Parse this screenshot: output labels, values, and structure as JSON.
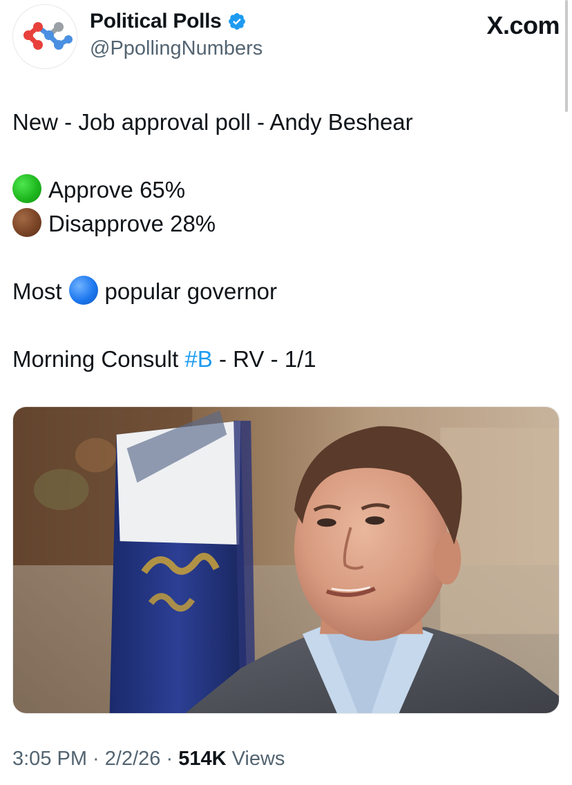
{
  "author": {
    "display_name": "Political Polls",
    "handle": "@PpollingNumbers",
    "avatar_icon": "network-molecule-logo",
    "verified_icon": "verified-badge-icon",
    "verified_color": "#1d9bf0"
  },
  "brand": {
    "label": "X.com"
  },
  "tweet": {
    "headline": "New - Job approval poll - Andy Beshear",
    "approve": {
      "icon": "green-circle",
      "color": "#1fb81f",
      "label": "Approve 65%"
    },
    "disapprove": {
      "icon": "brown-circle",
      "color": "#7a4426",
      "label": "Disapprove 28%"
    },
    "ranking": {
      "prefix": "Most",
      "icon": "blue-circle",
      "color": "#1e78ef",
      "suffix": "popular governor"
    },
    "source": {
      "prefix": "Morning Consult ",
      "hashtag": "#B",
      "suffix": " - RV - 1/1"
    }
  },
  "media": {
    "type": "photo",
    "subject": "man in plaid blazer and light blue shirt in front of blue and white flag"
  },
  "meta": {
    "time": "3:05 PM",
    "separator": " · ",
    "date": "2/2/26",
    "views_count": "514K",
    "views_label": " Views"
  },
  "colors": {
    "text": "#0f1419",
    "secondary": "#536471",
    "link": "#1d9bf0"
  }
}
